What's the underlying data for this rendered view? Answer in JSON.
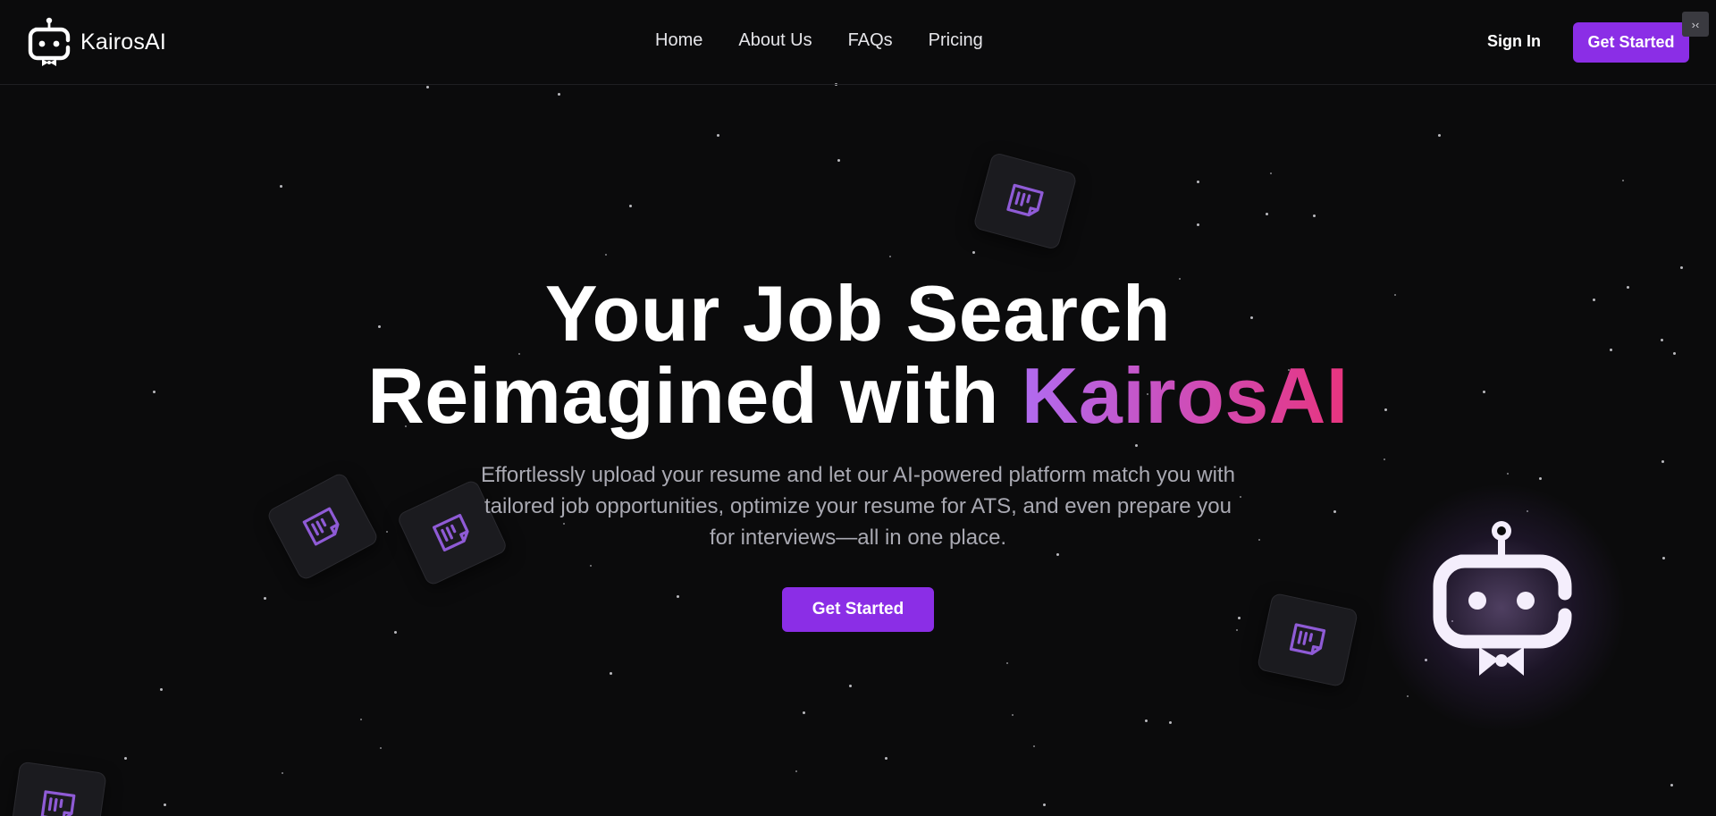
{
  "brand": {
    "name": "KairosAI",
    "logo_icon": "robot-icon"
  },
  "nav": {
    "items": [
      {
        "label": "Home"
      },
      {
        "label": "About Us"
      },
      {
        "label": "FAQs"
      },
      {
        "label": "Pricing"
      }
    ]
  },
  "header": {
    "signin_label": "Sign In",
    "cta_label": "Get Started",
    "corner_icon": "collapse-icon"
  },
  "hero": {
    "title_line1": "Your Job Search",
    "title_line2_prefix": "Reimagined with ",
    "title_line2_accent": "KairosAI",
    "subtitle": "Effortlessly upload your resume and let our AI-powered platform match you with tailored job opportunities, optimize your resume for ATS, and even prepare you for interviews—all in one place.",
    "cta_label": "Get Started"
  },
  "decor": {
    "card_icon": "resume-document-icon",
    "mascot_icon": "robot-mascot-icon"
  },
  "colors": {
    "background": "#0b0b0c",
    "primary": "#8b2ee6",
    "accent_gradient_start": "#b06bf0",
    "accent_gradient_end": "#e8347e",
    "card_icon": "#8f5bd6"
  }
}
